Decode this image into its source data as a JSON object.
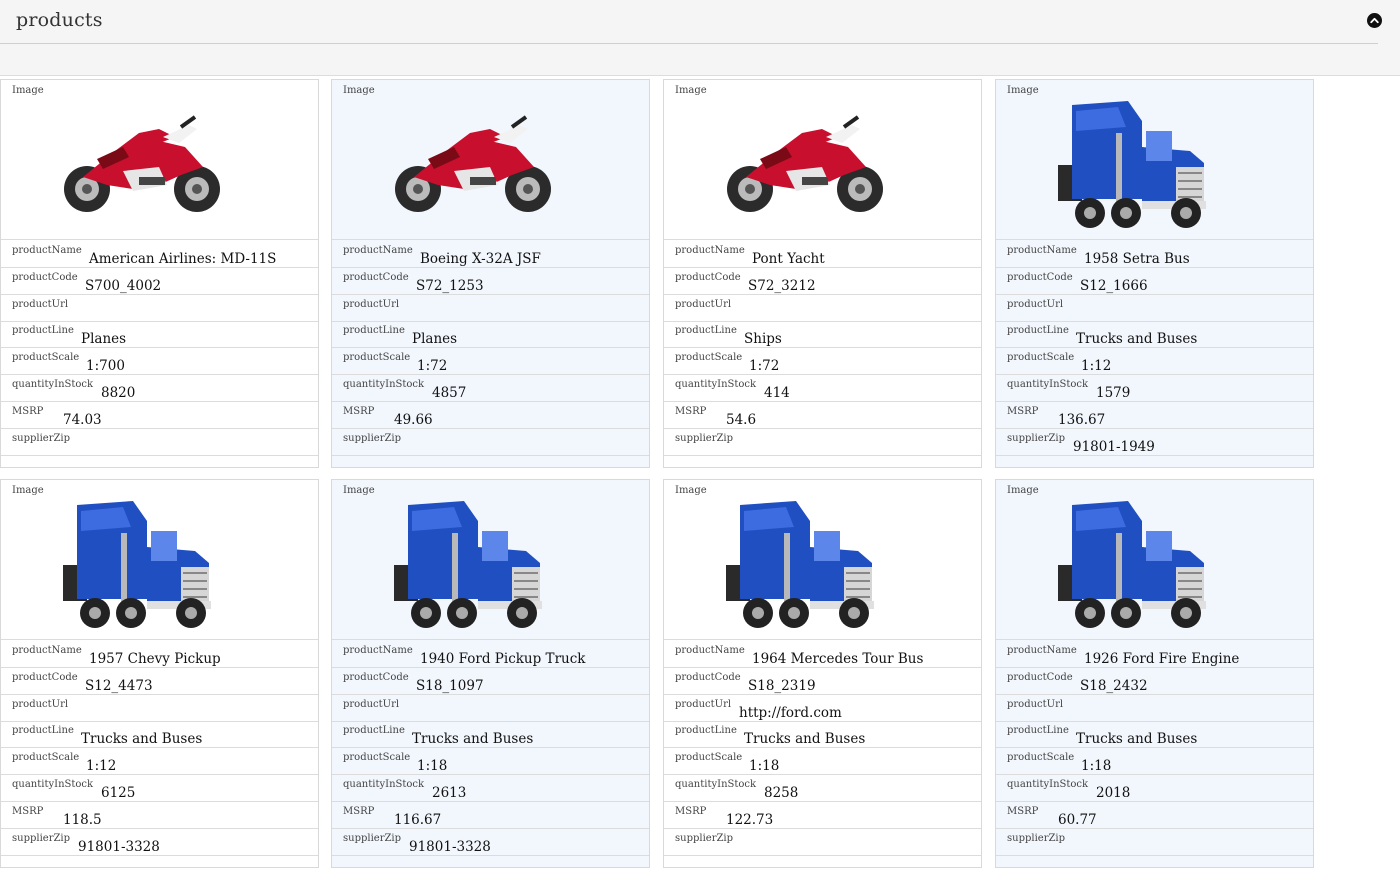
{
  "header": {
    "title": "products"
  },
  "field_labels": {
    "image": "Image",
    "productName": "productName",
    "productCode": "productCode",
    "productUrl": "productUrl",
    "productLine": "productLine",
    "productScale": "productScale",
    "quantityInStock": "quantityInStock",
    "MSRP": "MSRP",
    "supplierZip": "supplierZip"
  },
  "icons": {
    "collapse": "chevron-up-circle-icon"
  },
  "colors": {
    "motorcycle_red": "#c8102e",
    "truck_blue": "#1f4fc0",
    "alt_card_bg": "#f2f7fd"
  },
  "products": [
    {
      "image": "motorcycle",
      "productName": "American Airlines: MD-11S",
      "productCode": "S700_4002",
      "productUrl": "",
      "productLine": "Planes",
      "productScale": "1:700",
      "quantityInStock": "8820",
      "MSRP": "74.03",
      "supplierZip": ""
    },
    {
      "image": "motorcycle",
      "productName": "Boeing X-32A JSF",
      "productCode": "S72_1253",
      "productUrl": "",
      "productLine": "Planes",
      "productScale": "1:72",
      "quantityInStock": "4857",
      "MSRP": "49.66",
      "supplierZip": ""
    },
    {
      "image": "motorcycle",
      "productName": "Pont Yacht",
      "productCode": "S72_3212",
      "productUrl": "",
      "productLine": "Ships",
      "productScale": "1:72",
      "quantityInStock": "414",
      "MSRP": "54.6",
      "supplierZip": ""
    },
    {
      "image": "truck",
      "productName": "1958 Setra Bus",
      "productCode": "S12_1666",
      "productUrl": "",
      "productLine": "Trucks and Buses",
      "productScale": "1:12",
      "quantityInStock": "1579",
      "MSRP": "136.67",
      "supplierZip": "91801-1949"
    },
    {
      "image": "truck",
      "productName": "1957 Chevy Pickup",
      "productCode": "S12_4473",
      "productUrl": "",
      "productLine": "Trucks and Buses",
      "productScale": "1:12",
      "quantityInStock": "6125",
      "MSRP": "118.5",
      "supplierZip": "91801-3328"
    },
    {
      "image": "truck",
      "productName": "1940 Ford Pickup Truck",
      "productCode": "S18_1097",
      "productUrl": "",
      "productLine": "Trucks and Buses",
      "productScale": "1:18",
      "quantityInStock": "2613",
      "MSRP": "116.67",
      "supplierZip": "91801-3328"
    },
    {
      "image": "truck",
      "productName": "1964 Mercedes Tour Bus",
      "productCode": "S18_2319",
      "productUrl": "http://ford.com",
      "productLine": "Trucks and Buses",
      "productScale": "1:18",
      "quantityInStock": "8258",
      "MSRP": "122.73",
      "supplierZip": ""
    },
    {
      "image": "truck",
      "productName": "1926 Ford Fire Engine",
      "productCode": "S18_2432",
      "productUrl": "",
      "productLine": "Trucks and Buses",
      "productScale": "1:18",
      "quantityInStock": "2018",
      "MSRP": "60.77",
      "supplierZip": ""
    }
  ]
}
